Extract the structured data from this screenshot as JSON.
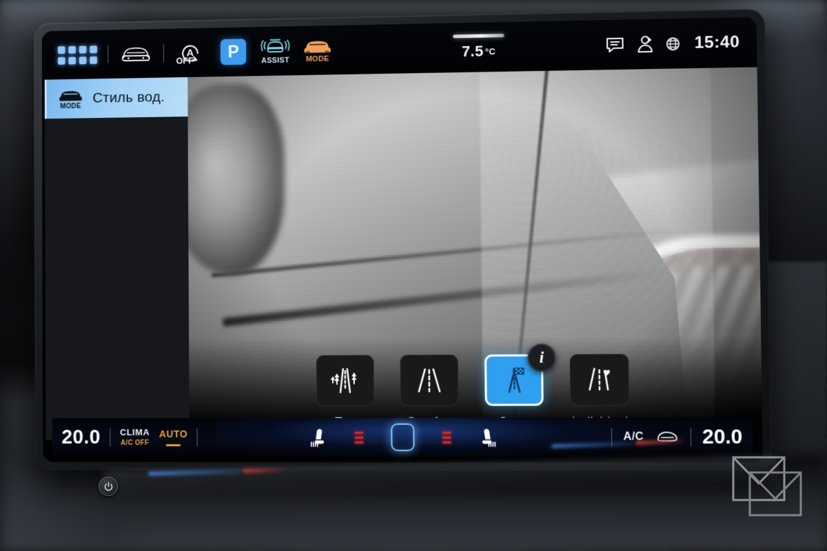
{
  "status_bar": {
    "app_grid": {
      "icon": "apps-grid-icon",
      "tiles": 8
    },
    "vehicle_button": {
      "icon": "car-front-icon"
    },
    "auto_start_stop": {
      "icon": "auto-start-stop-icon",
      "letter": "A",
      "label": "OFF"
    },
    "park_button": {
      "icon": "park-brake-icon",
      "label": "P"
    },
    "assist_button": {
      "icon": "travel-assist-icon",
      "label": "ASSIST"
    },
    "mode_button": {
      "icon": "drive-mode-car-icon",
      "label": "MODE"
    },
    "outside_temperature": {
      "value": "7.5",
      "unit": "°C"
    },
    "message_icon": "message-bubble-icon",
    "profile_icon": "user-profile-icon",
    "globe_icon": "globe-icon",
    "clock": "15:40"
  },
  "sidebar": {
    "header": {
      "icon": "car-mode-icon",
      "icon_sublabel": "MODE",
      "title": "Стиль вод."
    }
  },
  "drive_modes": {
    "info_badge": {
      "icon": "info-icon",
      "label": "i"
    },
    "items": [
      {
        "id": "eco",
        "label": "Eco",
        "icon": "road-with-trees-icon",
        "selected": false
      },
      {
        "id": "comfort",
        "label": "Comfort",
        "icon": "road-straight-icon",
        "selected": false
      },
      {
        "id": "sport",
        "label": "Sport",
        "icon": "road-checkered-flag-icon",
        "selected": true
      },
      {
        "id": "individual",
        "label": "Individual",
        "icon": "road-with-heart-icon",
        "selected": false
      }
    ]
  },
  "climate_bar": {
    "left_temperature": "20.0",
    "clima": {
      "title": "CLIMA",
      "status": "A/C OFF"
    },
    "auto": {
      "label": "AUTO",
      "active": true
    },
    "left_seat_heater": {
      "icon": "heated-seat-left-icon",
      "level": 3
    },
    "home_button": {
      "icon": "home-square-icon"
    },
    "right_seat_heater": {
      "icon": "heated-seat-right-icon",
      "level": 3
    },
    "ac_label": "A/C",
    "defrost_icon": "rear-defrost-icon",
    "right_temperature": "20.0"
  },
  "hardware": {
    "power_button": {
      "icon": "power-icon"
    }
  },
  "watermark": {
    "icon": "brand-logo-watermark"
  },
  "colors": {
    "accent_blue": "#2fa0ef",
    "park_blue": "#3d9bf0",
    "assist_cyan": "#7fd3e0",
    "mode_orange": "#f0a060",
    "amber": "#e8a23a",
    "heater_red": "#e02424",
    "sidebar_header": "#9fd0f5"
  }
}
